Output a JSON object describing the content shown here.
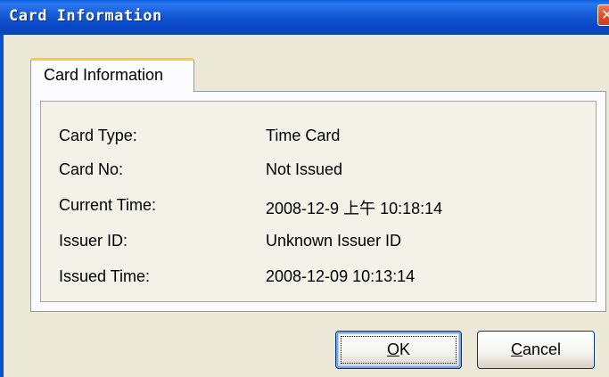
{
  "window": {
    "title": "Card Information"
  },
  "tab": {
    "label": "Card Information"
  },
  "fields": [
    {
      "label": "Card Type:",
      "value": "Time Card"
    },
    {
      "label": "Card No:",
      "value": "Not Issued"
    },
    {
      "label": "Current Time:",
      "value": "2008-12-9 上午 10:18:14"
    },
    {
      "label": "Issuer ID:",
      "value": "Unknown Issuer ID"
    },
    {
      "label": "Issued Time:",
      "value": "2008-12-09 10:13:14"
    }
  ],
  "buttons": {
    "ok": {
      "mnemonic": "O",
      "rest": "K"
    },
    "cancel": {
      "mnemonic": "C",
      "rest": "ancel"
    }
  },
  "icons": {
    "close": "close-icon"
  },
  "colors": {
    "titlebar": "#0A5FE0",
    "dialog_bg": "#ECE9D8",
    "tab_highlight": "#FFC83C",
    "close_button": "#E0502A"
  }
}
